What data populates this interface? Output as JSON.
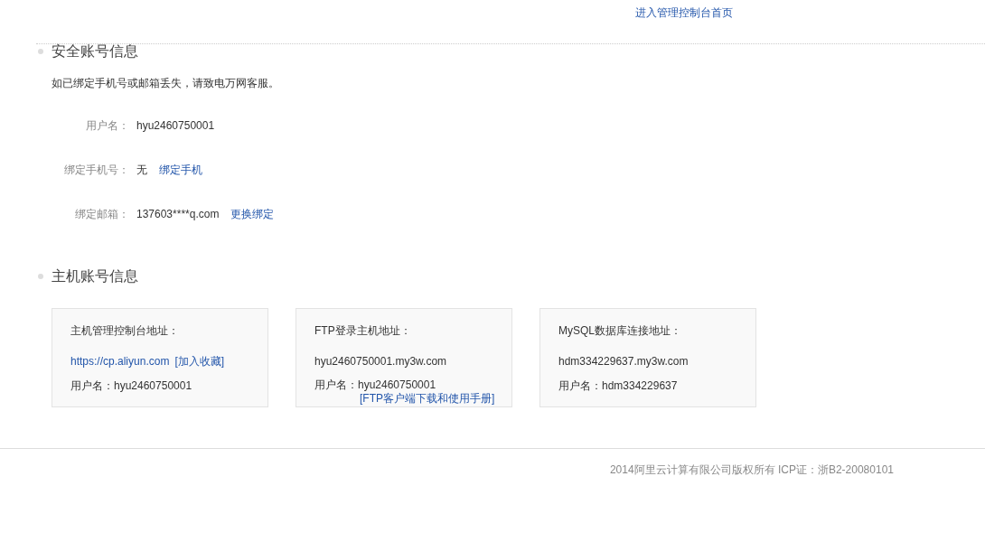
{
  "top_link": "进入管理控制台首页",
  "security": {
    "heading": "安全账号信息",
    "notice": "如已绑定手机号或邮箱丢失，请致电万网客服。",
    "rows": [
      {
        "label": "用户名：",
        "value": "hyu2460750001"
      },
      {
        "label": "绑定手机号：",
        "value": "无",
        "link": "绑定手机"
      },
      {
        "label": "绑定邮箱：",
        "value": "137603****q.com",
        "link": "更换绑定"
      }
    ]
  },
  "host": {
    "heading": "主机账号信息",
    "cards": [
      {
        "title": "主机管理控制台地址：",
        "address": "https://cp.aliyun.com",
        "address_is_link": true,
        "address_link": "[加入收藏]",
        "username_label": "用户名：",
        "username": "hyu2460750001"
      },
      {
        "title": "FTP登录主机地址：",
        "address": "hyu2460750001.my3w.com",
        "address_is_link": false,
        "username_label": "用户名：",
        "username": "hyu2460750001",
        "extra_link": "[FTP客户端下载和使用手册]"
      },
      {
        "title": "MySQL数据库连接地址：",
        "address": "hdm334229637.my3w.com",
        "address_is_link": false,
        "username_label": "用户名：",
        "username": "hdm334229637"
      }
    ]
  },
  "footer": "2014阿里云计算有限公司版权所有 ICP证：浙B2-20080101"
}
